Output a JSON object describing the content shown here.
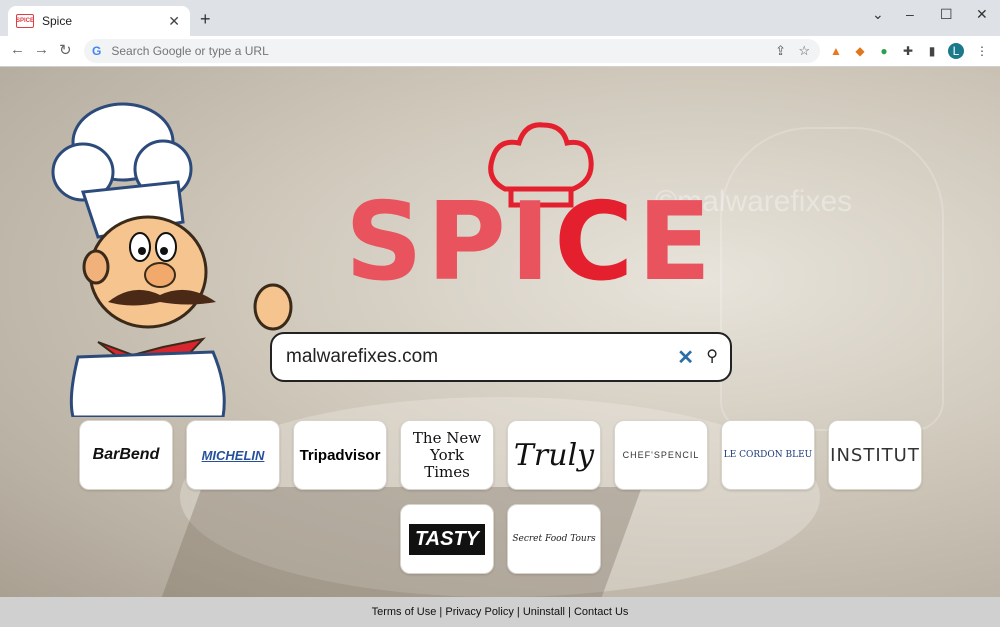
{
  "browser": {
    "tab_title": "Spice",
    "favicon_text": "SPICE",
    "new_tab_label": "+",
    "address_placeholder": "Search Google or type a URL",
    "google_icon": "G",
    "window_controls": [
      "⌄",
      "–",
      "☐",
      "✕"
    ]
  },
  "watermark": "©malwarefixes",
  "logo": {
    "text_before": "SPI",
    "text_c": "C",
    "text_after": "E"
  },
  "search": {
    "value": "malwarefixes.com",
    "clear_icon": "✕",
    "search_icon": "⚲"
  },
  "tiles": [
    {
      "label": "BarBend"
    },
    {
      "label": "MICHELIN"
    },
    {
      "label": "Tripadvisor"
    },
    {
      "label": "The New York Times"
    },
    {
      "label": "Truly"
    },
    {
      "label": "CHEF'SPENCIL"
    },
    {
      "label": "LE CORDON BLEU"
    },
    {
      "label": "INSTITUT"
    },
    {
      "label": "TASTY"
    },
    {
      "label": "Secret Food Tours"
    }
  ],
  "footer": {
    "terms": "Terms of Use",
    "privacy": "Privacy Policy",
    "uninstall": "Uninstall",
    "contact": "Contact Us",
    "separator": " | "
  },
  "colors": {
    "logo_red": "#e8535e",
    "logo_red_dark": "#e4202e",
    "hat_red": "#e4202e"
  }
}
